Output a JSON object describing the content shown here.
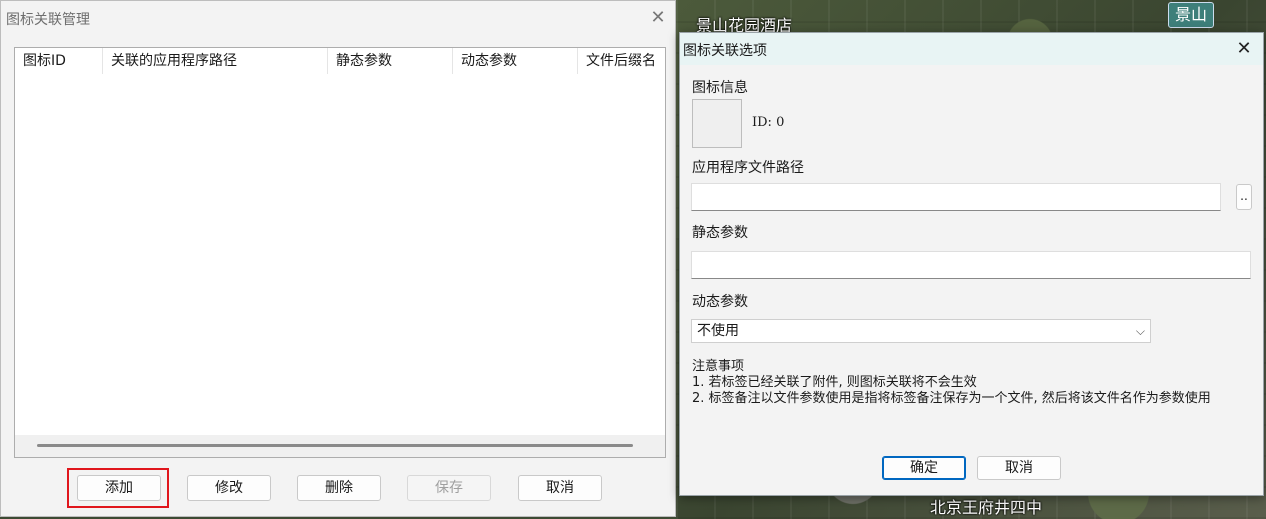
{
  "map": {
    "labels": [
      "景山花园酒店",
      "北京王府井四中"
    ],
    "badge": "景山"
  },
  "manager_dialog": {
    "title": "图标关联管理",
    "columns": [
      "图标ID",
      "关联的应用程序路径",
      "静态参数",
      "动态参数",
      "文件后缀名"
    ],
    "rows": [],
    "buttons": {
      "add": "添加",
      "modify": "修改",
      "delete": "删除",
      "save": "保存",
      "cancel": "取消"
    }
  },
  "options_dialog": {
    "title": "图标关联选项",
    "icon_info_label": "图标信息",
    "icon_id_text": "ID: 0",
    "app_path_label": "应用程序文件路径",
    "app_path_value": "",
    "browse_label": "..",
    "static_params_label": "静态参数",
    "static_params_value": "",
    "dynamic_params_label": "动态参数",
    "dynamic_params_selected": "不使用",
    "notes": {
      "heading": "注意事项",
      "line1": "1. 若标签已经关联了附件, 则图标关联将不会生效",
      "line2": "2. 标签备注以文件参数使用是指将标签备注保存为一个文件, 然后将该文件名作为参数使用"
    },
    "ok_label": "确定",
    "cancel_label": "取消"
  },
  "icons": {
    "close": "close-icon",
    "dropdown": "chevron-down-icon"
  },
  "colors": {
    "highlight": "#e0161c",
    "primary_border": "#0067c0",
    "options_titlebar": "#e8f4f4"
  }
}
